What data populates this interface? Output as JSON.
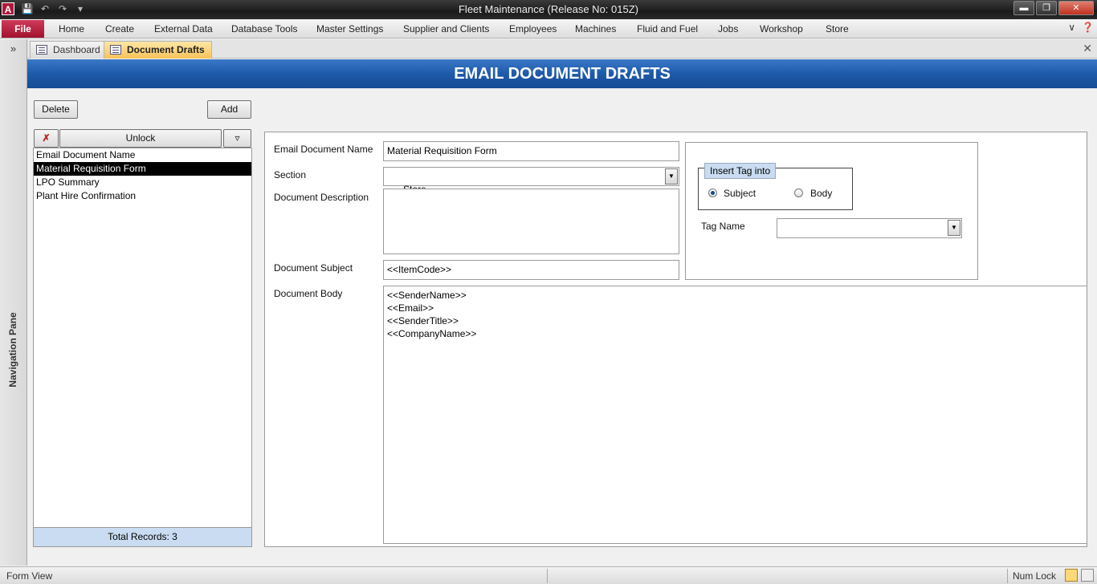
{
  "window": {
    "app_icon": "A",
    "title": "Fleet Maintenance (Release No: 015Z)",
    "min_glyph": "▬",
    "max_glyph": "❐",
    "close_glyph": "✕",
    "qat": [
      "save-icon",
      "undo-icon",
      "redo-icon",
      "customize-icon"
    ]
  },
  "ribbon": {
    "file_label": "File",
    "tabs": [
      "Home",
      "Create",
      "External Data",
      "Database Tools",
      "Master Settings",
      "Supplier and Clients",
      "Employees",
      "Machines",
      "Fluid and Fuel",
      "Jobs",
      "Workshop",
      "Store"
    ]
  },
  "nav_pane": {
    "label": "Navigation Pane",
    "toggle_glyph": "»"
  },
  "doc_tabs": [
    {
      "label": "Dashboard",
      "active": false
    },
    {
      "label": "Document Drafts",
      "active": true
    }
  ],
  "banner": {
    "title": "EMAIL DOCUMENT DRAFTS"
  },
  "toolbar": {
    "delete_label": "Delete",
    "add_label": "Add"
  },
  "list": {
    "unlock_label": "Unlock",
    "header": "Email Document Name",
    "items": [
      "Material Requisition Form",
      "LPO Summary",
      "Plant Hire Confirmation"
    ],
    "selected_index": 0,
    "footer": "Total Records: 3"
  },
  "form": {
    "name_label": "Email Document Name",
    "name_value": "Material Requisition Form",
    "section_label": "Section",
    "section_value": "Store",
    "description_label": "Document Description",
    "description_value": "",
    "subject_label": "Document Subject",
    "subject_value": "<<ItemCode>>",
    "body_label": "Document Body",
    "body_value": "<<SenderName>>\n<<Email>>\n<<SenderTitle>>\n<<CompanyName>>"
  },
  "tag_panel": {
    "group_title": "Insert Tag into",
    "option_subject": "Subject",
    "option_body": "Body",
    "selected": "Subject",
    "tag_name_label": "Tag Name",
    "tag_name_value": ""
  },
  "status": {
    "left": "Form View",
    "num_lock": "Num Lock"
  },
  "colors": {
    "banner": "#1e5aaa",
    "file_tab": "#b0173a",
    "active_tab": "#f6c35a",
    "list_footer": "#c9dcf1"
  }
}
